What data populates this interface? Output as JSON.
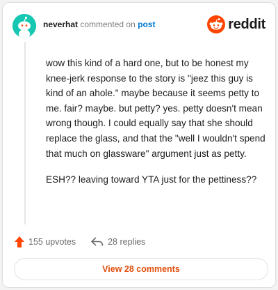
{
  "comment": {
    "username": "neverhat",
    "action_text": "commented on",
    "post_link": "post",
    "paragraphs": [
      "wow this kind of a hard one, but to be honest my knee-jerk response to the story is \"jeez this guy is kind of an ahole.\" maybe because it seems petty to me. fair? maybe. but petty? yes. petty doesn't mean wrong though. I could equally say that she should replace the glass, and that the \"well I wouldn't spend that much on glassware\" argument just as petty.",
      "ESH?? leaving toward YTA just for the pettiness??"
    ]
  },
  "brand": {
    "logo_text": "reddit",
    "color": "#ff4500"
  },
  "stats": {
    "upvotes": "155 upvotes",
    "replies": "28 replies"
  },
  "view_button": {
    "label": "View 28 comments"
  },
  "icons": {
    "upvote": "upvote-arrow-icon",
    "reply": "reply-arrow-icon",
    "avatar": "snoo-avatar-icon"
  }
}
